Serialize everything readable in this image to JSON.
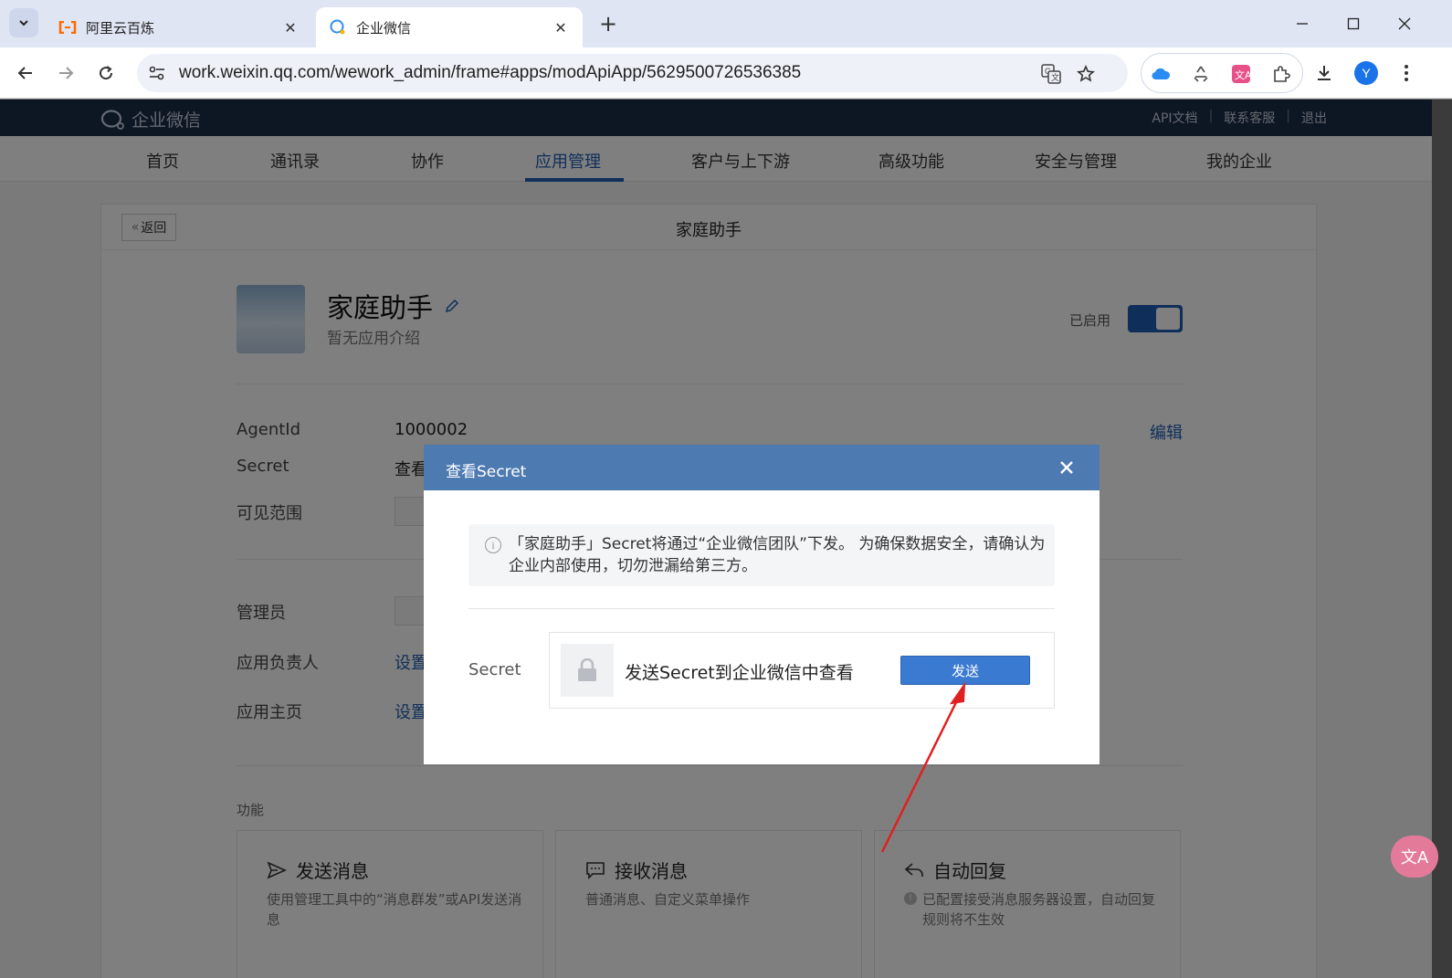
{
  "browser": {
    "tabs": [
      {
        "title": "阿里云百炼",
        "active": false
      },
      {
        "title": "企业微信",
        "active": true
      }
    ],
    "url": "work.weixin.qq.com/wework_admin/frame#apps/modApiApp/5629500726536385",
    "profile_initial": "Y"
  },
  "site": {
    "brand": "企业微信",
    "top_links": [
      "API文档",
      "联系客服",
      "退出"
    ],
    "nav": [
      "首页",
      "通讯录",
      "协作",
      "应用管理",
      "客户与上下游",
      "高级功能",
      "安全与管理",
      "我的企业"
    ],
    "active_nav": "应用管理"
  },
  "app": {
    "back_label": "返回",
    "page_title": "家庭助手",
    "name": "家庭助手",
    "description": "暂无应用介绍",
    "status_label": "已启用",
    "edit_label": "编辑",
    "fields": {
      "agentid_label": "AgentId",
      "agentid_value": "1000002",
      "secret_label": "Secret",
      "secret_value": "查看",
      "visible_label": "可见范围",
      "admin_label": "管理员",
      "owner_label": "应用负责人",
      "owner_value": "设置",
      "homepage_label": "应用主页",
      "homepage_value": "设置"
    },
    "features_title": "功能",
    "features": [
      {
        "title": "发送消息",
        "desc": "使用管理工具中的“消息群发”或API发送消息"
      },
      {
        "title": "接收消息",
        "desc": "普通消息、自定义菜单操作"
      },
      {
        "title": "自动回复",
        "desc": "已配置接受消息服务器设置，自动回复规则将不生效"
      }
    ]
  },
  "modal": {
    "title": "查看Secret",
    "notice": "「家庭助手」Secret将通过“企业微信团队”下发。 为确保数据安全，请确认为企业内部使用，切勿泄漏给第三方。",
    "secret_label": "Secret",
    "secret_text": "发送Secret到企业微信中查看",
    "send_label": "发送"
  },
  "colors": {
    "accent": "#1e5fb4",
    "modal_header": "#4d7ab1",
    "brand_bar": "#1b2c46",
    "annotation_arrow": "#e02020"
  }
}
